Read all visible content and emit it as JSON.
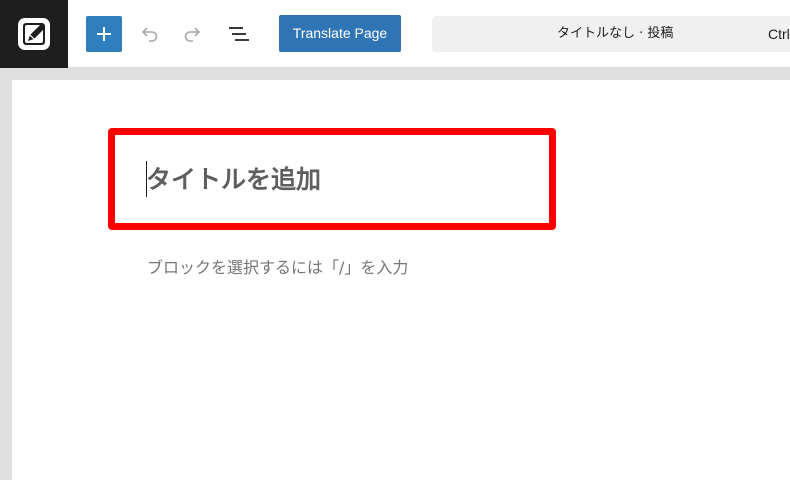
{
  "toolbar": {
    "logo_icon": "wordpress-edit-logo-icon",
    "inserter_icon": "plus-icon",
    "undo_icon": "undo-icon",
    "redo_icon": "redo-icon",
    "outline_icon": "document-outline-icon",
    "translate_label": "Translate Page",
    "doc_title": "タイトルなし · 投稿",
    "shortcut_hint": "Ctrl"
  },
  "editor": {
    "title_placeholder": "タイトルを追加",
    "block_placeholder": "ブロックを選択するには「/」を入力"
  },
  "colors": {
    "accent": "#2f7fbf",
    "translate_button": "#2f74b4",
    "highlight": "#ff0000",
    "logo_bg": "#1e1e1e"
  }
}
